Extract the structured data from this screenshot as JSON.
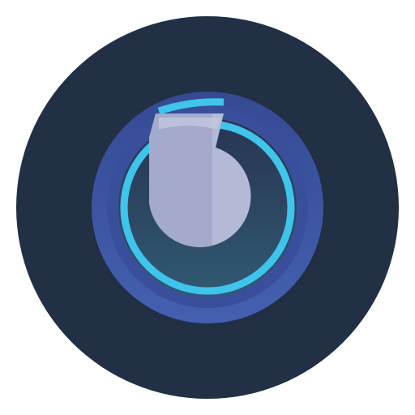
{
  "icon": {
    "semantic": "app-launcher-icon",
    "shape": "circle",
    "colors": {
      "outer_disc": "#223045",
      "inner_halo": "#1f2b40",
      "blue_ring": "#3d53a0",
      "blue_ring_edge": "#34478a",
      "inner_well_top": "#2a3656",
      "inner_well_bottom": "#315a73",
      "accent_ring": "#3fc4ec",
      "glyph": "#b4bad6",
      "glyph_shadow": "#a3aacb",
      "glyph_highlight": "#c3c8e0"
    }
  }
}
